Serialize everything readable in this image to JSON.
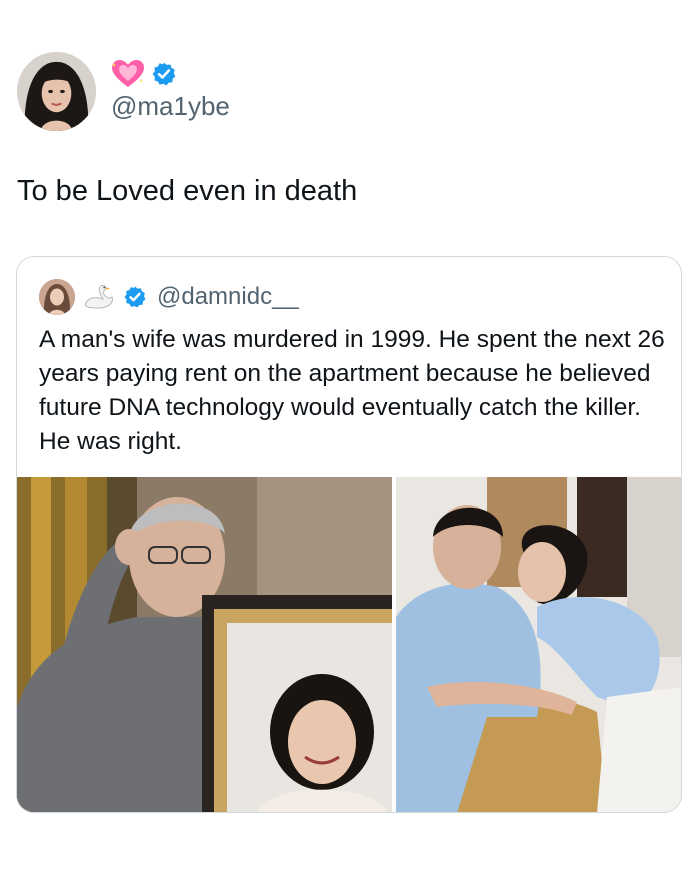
{
  "tweet": {
    "handle": "@ma1ybe",
    "text": "To be Loved even in death",
    "badges": [
      "heart-emoji",
      "verified-badge"
    ]
  },
  "quoted_tweet": {
    "handle": "@damnidc__",
    "badges": [
      "swan-emoji",
      "verified-badge"
    ],
    "text": "A man's wife was murdered in 1999. He spent the next 26 years paying rent on the apartment because he believed future DNA technology would eventually catch the killer. He was right."
  },
  "colors": {
    "verified": "#1d9bf0",
    "heart": "#ff5fa8",
    "secondary_text": "#536471",
    "border": "#cfd9de"
  }
}
